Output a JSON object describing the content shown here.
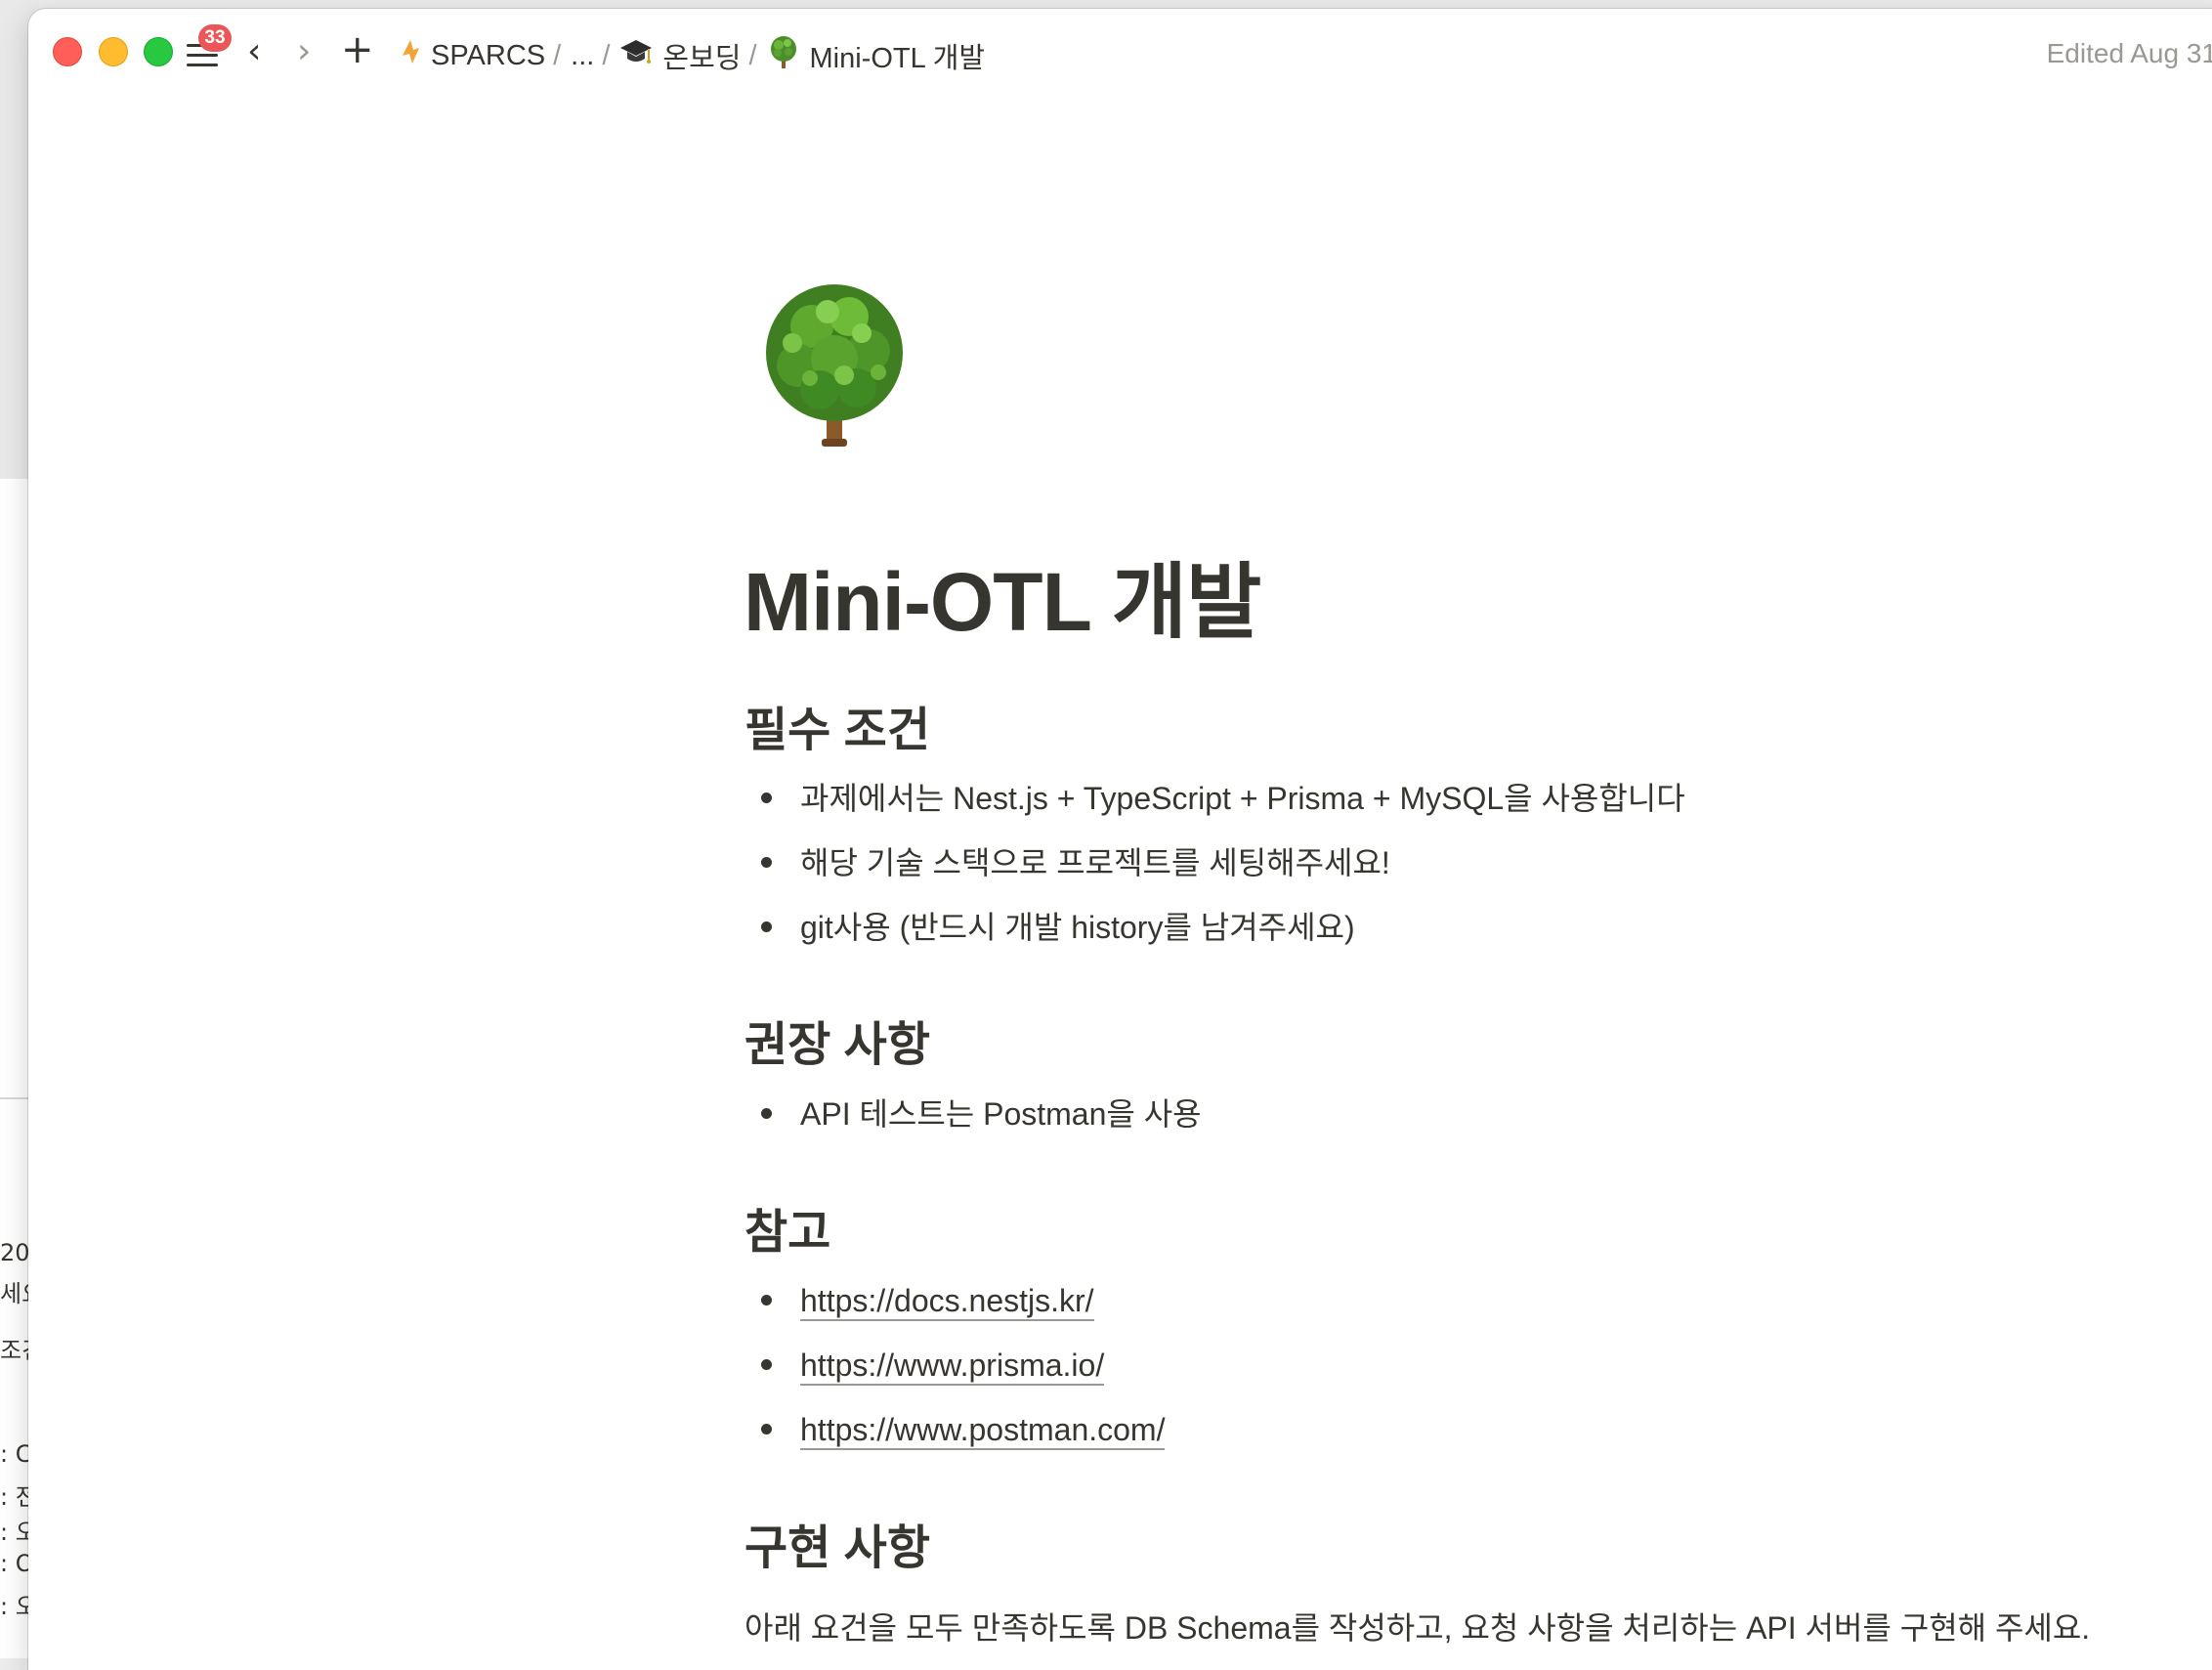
{
  "background_window": {
    "fragments": [
      "20",
      "세요",
      "조건",
      ": C",
      ": 전",
      ": 오",
      ": O",
      ": 오"
    ]
  },
  "titlebar": {
    "notification_count": "33",
    "breadcrumb": [
      {
        "icon": "sparcs-logo-icon",
        "label": "SPARCS"
      },
      {
        "icon": "",
        "label": "..."
      },
      {
        "icon": "graduation-cap-icon",
        "label": "온보딩"
      },
      {
        "icon": "tree-icon",
        "label": "Mini-OTL 개발"
      }
    ],
    "separator": "/",
    "edited": "Edited Aug 31"
  },
  "page": {
    "icon": "tree-icon",
    "title": "Mini-OTL 개발",
    "sections": [
      {
        "heading": "필수 조건",
        "items": [
          "과제에서는 Nest.js + TypeScript + Prisma + MySQL을 사용합니다",
          "해당 기술 스택으로 프로젝트를 세팅해주세요!",
          "git사용 (반드시 개발 history를 남겨주세요)"
        ]
      },
      {
        "heading": "권장 사항",
        "items": [
          "API 테스트는 Postman을 사용"
        ]
      },
      {
        "heading": "참고",
        "links": [
          "https://docs.nestjs.kr/",
          "https://www.prisma.io/",
          "https://www.postman.com/"
        ]
      },
      {
        "heading": "구현 사항",
        "paragraph": "아래 요건을 모두 만족하도록 DB Schema를 작성하고, 요청 사항을 처리하는 API 서버를 구현해 주세요."
      }
    ]
  },
  "colors": {
    "text": "#37352f",
    "muted": "#9a9893",
    "badge": "#eb5757",
    "close": "#ff5f57",
    "minimize": "#febc2e",
    "maximize": "#28c840"
  }
}
